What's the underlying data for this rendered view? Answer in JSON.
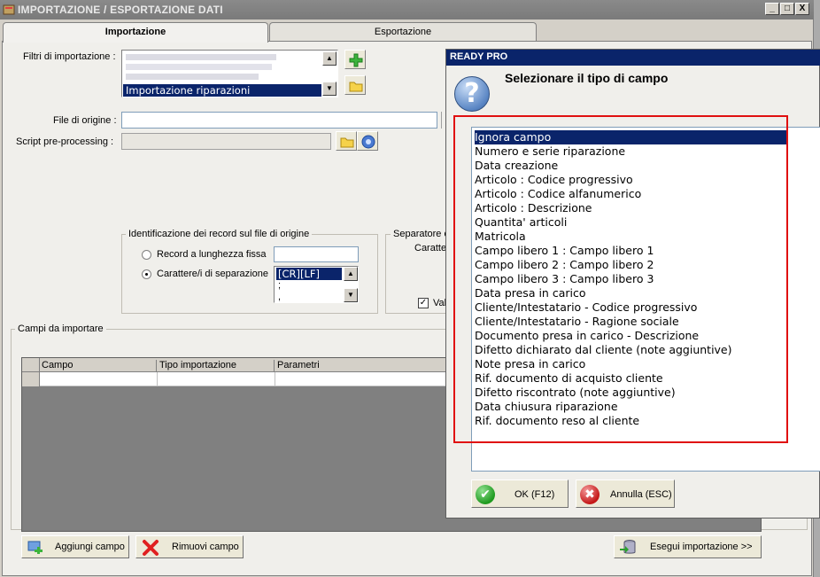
{
  "window": {
    "title": "IMPORTAZIONE / ESPORTAZIONE DATI",
    "controls": [
      "_",
      "□",
      "X"
    ]
  },
  "tabs": [
    {
      "label": "Importazione",
      "active": true
    },
    {
      "label": "Esportazione",
      "active": false
    }
  ],
  "import_form": {
    "filters_label": "Filtri di importazione :",
    "filters_selected": "Importazione riparazioni",
    "file_origin_label": "File di origine :",
    "script_label": "Script pre-processing :",
    "record_group_title": "Identificazione dei record sul file di origine",
    "radio_fixed_label": "Record a lunghezza fissa",
    "radio_sep_label": "Carattere/i di separazione",
    "separator_options": [
      "[CR][LF]",
      ";",
      ","
    ],
    "separator_group_title": "Separatore c",
    "separator_sub_label": "Caratte",
    "checkbox_label": "Val",
    "fields_group_title": "Campi da importare",
    "table_columns": [
      "Campo",
      "Tipo importazione",
      "Parametri"
    ],
    "add_button": "Aggiungi campo",
    "remove_button": "Rimuovi campo",
    "run_button": "Esegui importazione >>"
  },
  "dialog": {
    "title": "READY PRO",
    "heading": "Selezionare il tipo di campo",
    "items": [
      "Ignora campo",
      "Numero e serie riparazione",
      "Data creazione",
      "Articolo : Codice progressivo",
      "Articolo : Codice alfanumerico",
      "Articolo : Descrizione",
      "Quantita' articoli",
      "Matricola",
      "Campo libero 1 : Campo libero 1",
      "Campo libero 2 : Campo libero 2",
      "Campo libero 3 : Campo libero 3",
      "Data presa in carico",
      "Cliente/Intestatario - Codice progressivo",
      "Cliente/Intestatario - Ragione sociale",
      "Documento presa in carico - Descrizione",
      "Difetto dichiarato dal cliente (note aggiuntive)",
      "Note presa in carico",
      "Rif. documento di acquisto cliente",
      "Difetto riscontrato (note aggiuntive)",
      "Data chiusura riparazione",
      "Rif. documento reso al cliente"
    ],
    "selected_index": 0,
    "ok_button": "OK (F12)",
    "cancel_button": "Annulla (ESC)"
  },
  "colors": {
    "title_bar": "#7a7a7a",
    "dialog_title_bar": "#0a246a",
    "selection": "#0a246a",
    "highlight_box": "#e01010"
  }
}
